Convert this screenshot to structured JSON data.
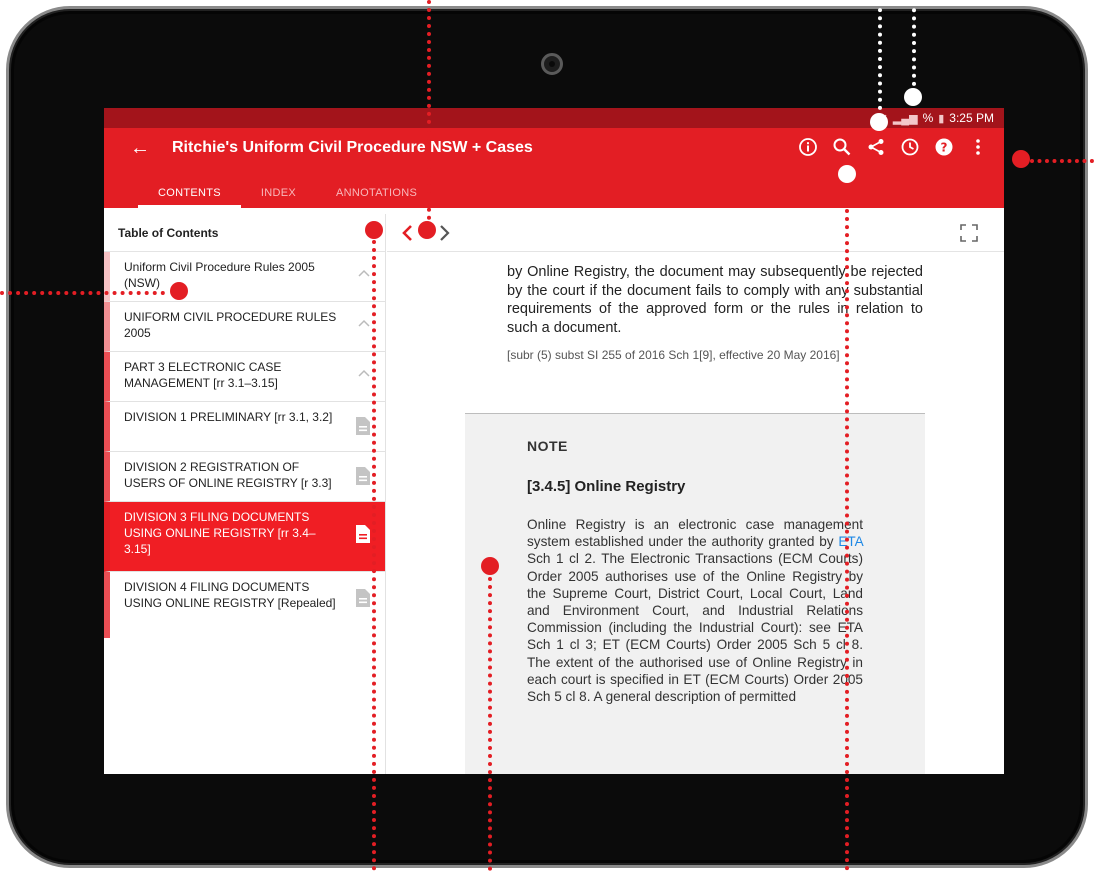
{
  "status_bar": {
    "battery": "%",
    "time": "3:25 PM"
  },
  "app_bar": {
    "back_icon": "arrow-left-icon",
    "title": "Ritchie's Uniform Civil Procedure NSW + Cases",
    "actions": [
      "info-icon",
      "search-icon",
      "share-icon",
      "history-icon",
      "help-icon",
      "more-vert-icon"
    ]
  },
  "tabs": [
    {
      "label": "CONTENTS",
      "active": true
    },
    {
      "label": "INDEX",
      "active": false
    },
    {
      "label": "ANNOTATIONS",
      "active": false
    }
  ],
  "sidebar": {
    "header": "Table of Contents",
    "items": [
      {
        "label": "Uniform Civil Procedure Rules 2005 (NSW)",
        "icon": "chevron-up-icon"
      },
      {
        "label": "UNIFORM CIVIL PROCEDURE RULES 2005",
        "icon": "chevron-up-icon"
      },
      {
        "label": "PART 3 ELECTRONIC CASE MANAGEMENT [rr 3.1–3.15]",
        "icon": "chevron-up-icon"
      },
      {
        "label": "DIVISION 1 PRELIMINARY [rr 3.1, 3.2]",
        "icon": "document-icon"
      },
      {
        "label": "DIVISION 2 REGISTRATION OF USERS OF ONLINE REGISTRY [r 3.3]",
        "icon": "document-icon"
      },
      {
        "label": "DIVISION 3 FILING DOCUMENTS USING ONLINE REGISTRY [rr 3.4–3.15]",
        "icon": "document-icon",
        "selected": true
      },
      {
        "label": "DIVISION 4 FILING DOCUMENTS USING ONLINE REGISTRY [Repealed]",
        "icon": "document-icon"
      }
    ]
  },
  "content_toolbar": {
    "prev_icon": "chevron-left-icon",
    "next_icon": "chevron-right-icon",
    "fullscreen_icon": "fullscreen-icon"
  },
  "content": {
    "paragraph": "by Online Registry, the document may subsequently be rejected by the court if the document fails to comply with any substantial requirements of the approved form or the rules in relation to such a document.",
    "source_note": "[subr (5) subst SI 255 of 2016 Sch 1[9], effective 20 May 2016]",
    "note_label": "NOTE",
    "note_heading": "[3.4.5] Online Registry",
    "note_body_before": "Online Registry is an electronic case management system established under the authority granted by ",
    "note_link": "ETA",
    "note_body_after": " Sch 1 cl 2. The Electronic Transactions (ECM Courts) Order 2005 authorises use of the Online Registry by the Supreme Court, District Court, Local Court, Land and Environment Court, and Industrial Relations Commission (including the Industrial Court): see ETA Sch 1 cl 3; ET (ECM Courts) Order 2005 Sch 5 cl 8. The extent of the authorised use of Online Registry in each court is specified in ET (ECM Courts) Order 2005 Sch 5 cl 8. A general description of permitted"
  },
  "colors": {
    "primary": "#e31e24",
    "status_bar": "#a3141b",
    "selected": "#f01e24",
    "link": "#1e88e5"
  }
}
